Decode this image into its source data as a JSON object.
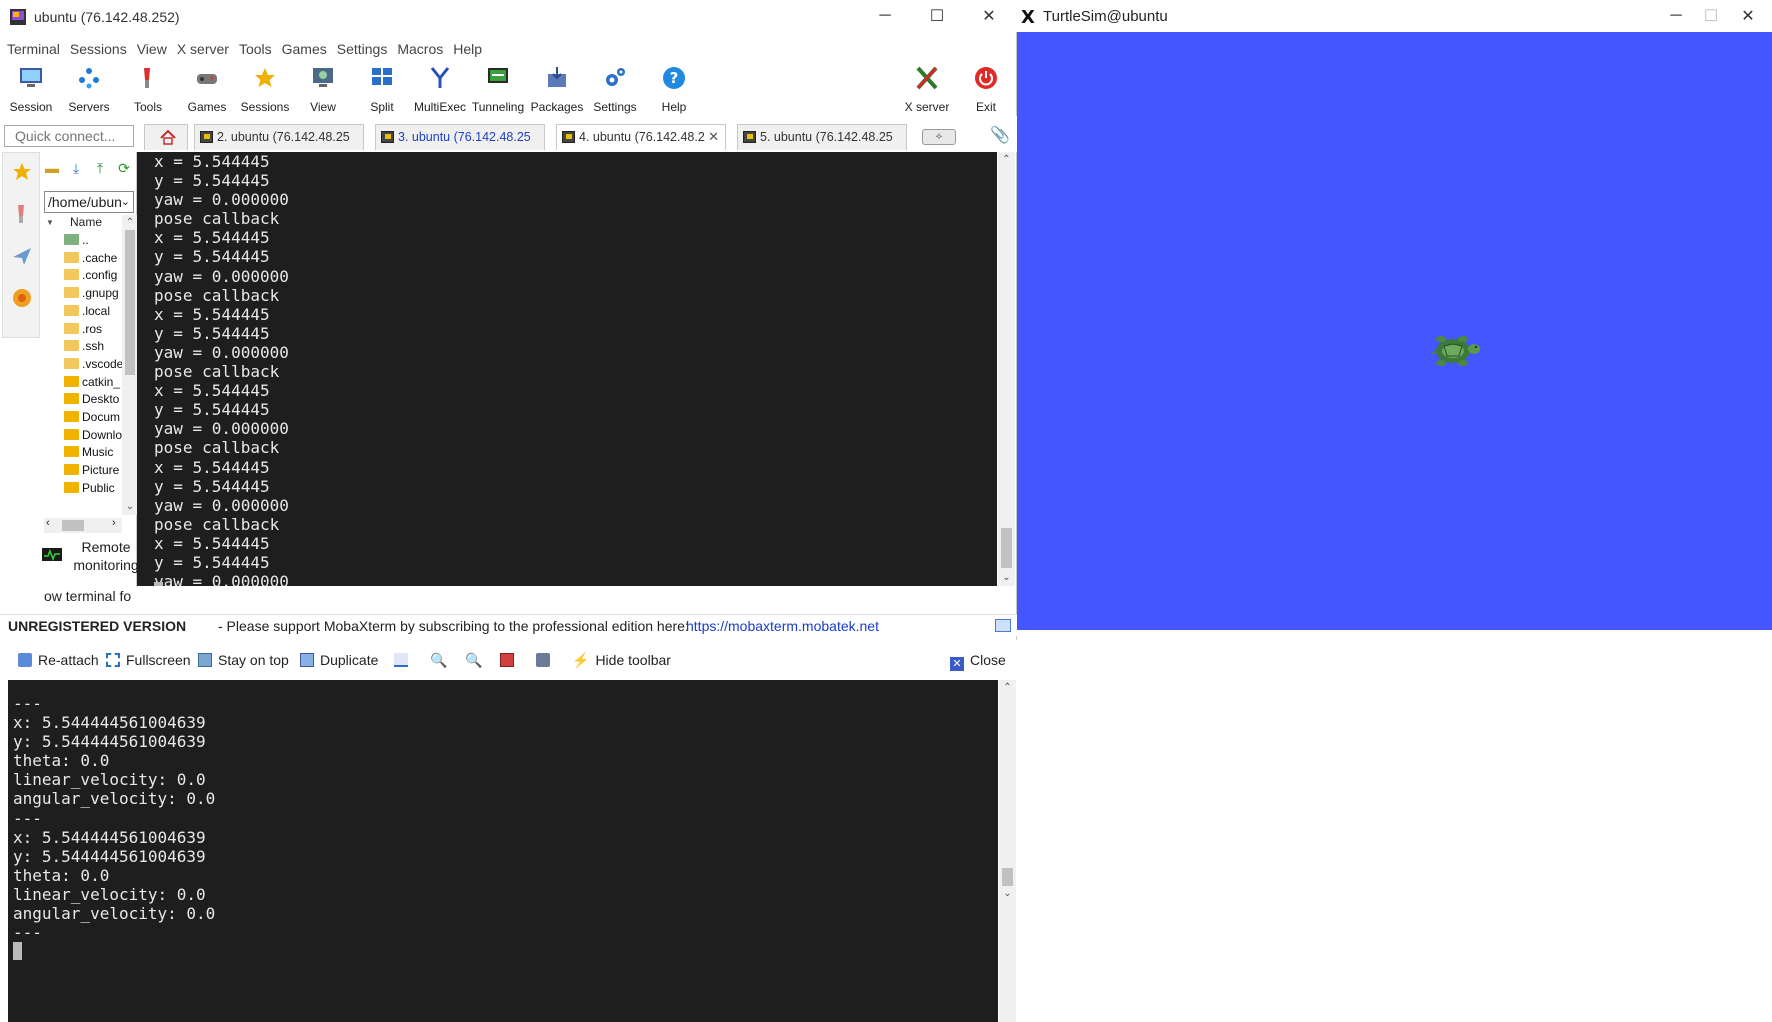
{
  "moba": {
    "title": "ubuntu (76.142.48.252)",
    "menu": [
      "Terminal",
      "Sessions",
      "View",
      "X server",
      "Tools",
      "Games",
      "Settings",
      "Macros",
      "Help"
    ],
    "toolbar": {
      "session": "Session",
      "servers": "Servers",
      "tools": "Tools",
      "games": "Games",
      "sessions": "Sessions",
      "view": "View",
      "split": "Split",
      "multiexec": "MultiExec",
      "tunneling": "Tunneling",
      "packages": "Packages",
      "settings": "Settings",
      "help": "Help",
      "xserver": "X server",
      "exit": "Exit"
    },
    "quick_connect_placeholder": "Quick connect...",
    "tabs": [
      {
        "label": "2. ubuntu (76.142.48.25"
      },
      {
        "label": "3. ubuntu (76.142.48.25"
      },
      {
        "label": "4. ubuntu (76.142.48.2"
      },
      {
        "label": "5. ubuntu (76.142.48.25"
      }
    ],
    "sftp": {
      "path": "/home/ubun",
      "name_header": "Name",
      "files": [
        "..",
        ".cache",
        ".config",
        ".gnupg",
        ".local",
        ".ros",
        ".ssh",
        ".vscode",
        "catkin_",
        "Deskto",
        "Docum",
        "Downlo",
        "Music",
        "Picture",
        "Public"
      ],
      "remote_monitoring": "Remote monitoring",
      "follow_terminal": "ow terminal fo"
    },
    "terminal_top": "x = 5.544445\ny = 5.544445\nyaw = 0.000000\npose callback\nx = 5.544445\ny = 5.544445\nyaw = 0.000000\npose callback\nx = 5.544445\ny = 5.544445\nyaw = 0.000000\npose callback\nx = 5.544445\ny = 5.544445\nyaw = 0.000000\npose callback\nx = 5.544445\ny = 5.544445\nyaw = 0.000000\npose callback\nx = 5.544445\ny = 5.544445\nyaw = 0.000000",
    "status": {
      "unregistered": "UNREGISTERED VERSION",
      "message": "-  Please support MobaXterm by subscribing to the professional edition here:",
      "link": "https://mobaxterm.mobatek.net"
    }
  },
  "detached": {
    "toolbar": {
      "reattach": "Re-attach",
      "fullscreen": "Fullscreen",
      "stay_on_top": "Stay on top",
      "duplicate": "Duplicate",
      "hide_toolbar": "Hide toolbar",
      "close": "Close"
    },
    "terminal": "---\nx: 5.544444561004639\ny: 5.544444561004639\ntheta: 0.0\nlinear_velocity: 0.0\nangular_velocity: 0.0\n---\nx: 5.544444561004639\ny: 5.544444561004639\ntheta: 0.0\nlinear_velocity: 0.0\nangular_velocity: 0.0\n---"
  },
  "turtlesim": {
    "title": "TurtleSim@ubuntu",
    "background_color": "#4556ff"
  }
}
